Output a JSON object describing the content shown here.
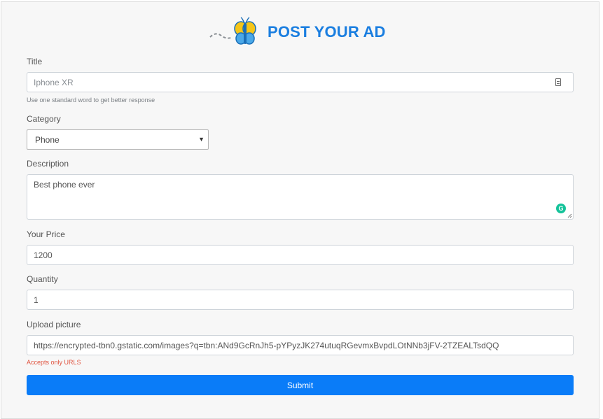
{
  "header": {
    "logo_text": "POST YOUR AD"
  },
  "form": {
    "title": {
      "label": "Title",
      "placeholder": "Iphone XR",
      "help": "Use one standard word to get better response"
    },
    "category": {
      "label": "Category",
      "selected": "Phone"
    },
    "description": {
      "label": "Description",
      "value": "Best phone ever"
    },
    "price": {
      "label": "Your Price",
      "value": "1200"
    },
    "quantity": {
      "label": "Quantity",
      "value": "1"
    },
    "picture": {
      "label": "Upload picture",
      "value": "https://encrypted-tbn0.gstatic.com/images?q=tbn:ANd9GcRnJh5-pYPyzJK274utuqRGevmxBvpdLOtNNb3jFV-2TZEALTsdQQ",
      "error": "Accepts only URLS"
    },
    "submit_label": "Submit"
  },
  "colors": {
    "accent": "#0a7cf8",
    "logo_blue": "#1a7ee0",
    "error": "#e0533f",
    "grammarly": "#15c39a"
  }
}
